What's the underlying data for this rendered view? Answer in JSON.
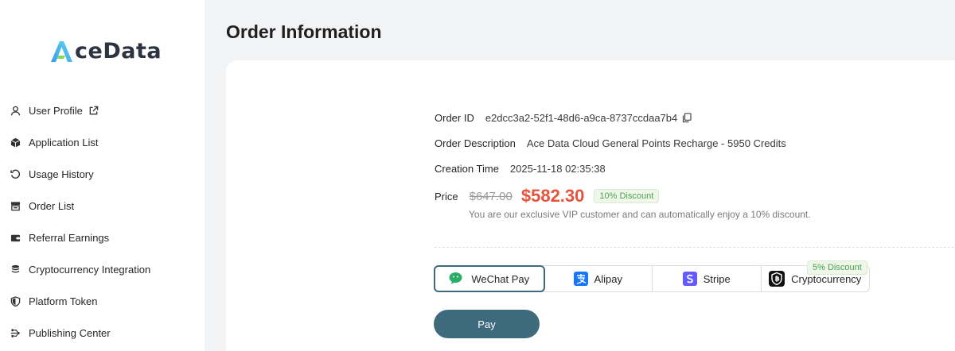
{
  "brand": {
    "name": "ceData",
    "accent": "#3e6a7d",
    "logo_colors": [
      "#5fd0f0",
      "#3aa0e8",
      "#7ed957"
    ]
  },
  "sidebar": {
    "items": [
      {
        "label": "User Profile",
        "icon": "user-icon",
        "external": true
      },
      {
        "label": "Application List",
        "icon": "cube-icon"
      },
      {
        "label": "Usage History",
        "icon": "history-icon"
      },
      {
        "label": "Order List",
        "icon": "store-icon"
      },
      {
        "label": "Referral Earnings",
        "icon": "wallet-icon"
      },
      {
        "label": "Cryptocurrency Integration",
        "icon": "coins-icon"
      },
      {
        "label": "Platform Token",
        "icon": "shield-icon"
      },
      {
        "label": "Publishing Center",
        "icon": "publish-icon"
      }
    ]
  },
  "page": {
    "title": "Order Information"
  },
  "order": {
    "id_label": "Order ID",
    "id_value": "e2dcc3a2-52f1-48d6-a9ca-8737ccdaa7b4",
    "desc_label": "Order Description",
    "desc_value": "Ace Data Cloud General Points Recharge - 5950 Credits",
    "time_label": "Creation Time",
    "time_value": "2025-11-18 02:35:38",
    "price_label": "Price",
    "original_price": "$647.00",
    "final_price": "$582.30",
    "discount_badge": "10% Discount",
    "vip_note": "You are our exclusive VIP customer and can automatically enjoy a 10% discount."
  },
  "payment": {
    "selected": "WeChat Pay",
    "options": [
      {
        "label": "WeChat Pay",
        "icon": "wechat-icon"
      },
      {
        "label": "Alipay",
        "icon": "alipay-icon"
      },
      {
        "label": "Stripe",
        "icon": "stripe-icon"
      },
      {
        "label": "Cryptocurrency",
        "icon": "crypto-icon"
      }
    ],
    "crypto_badge": "5% Discount",
    "pay_button": "Pay"
  },
  "colors": {
    "price_red": "#e5533d",
    "discount_green": "#4ca150",
    "wechat_green": "#2aae67",
    "alipay_blue": "#1677ff",
    "stripe_purple": "#635bff"
  }
}
